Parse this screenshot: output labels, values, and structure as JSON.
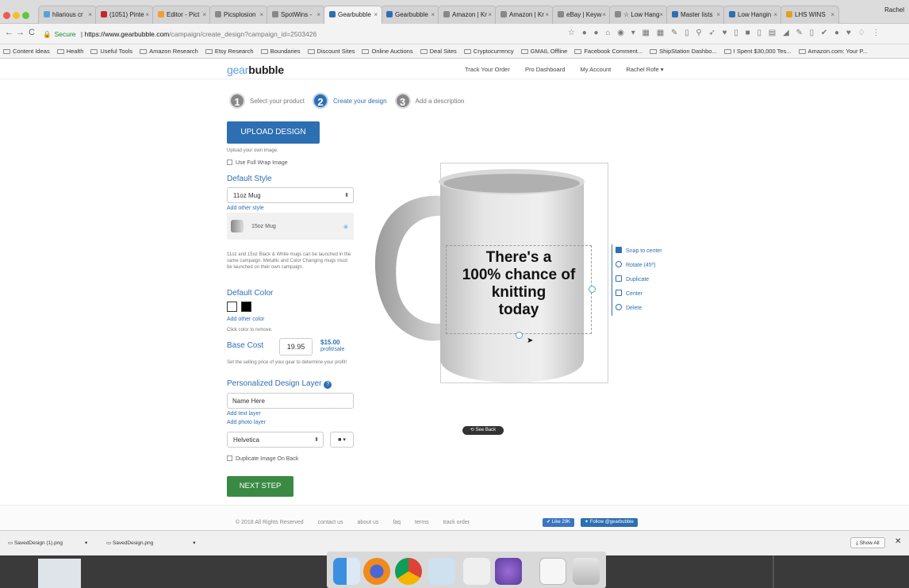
{
  "browser": {
    "tabs": [
      {
        "label": "hilarious cr",
        "color": "#5aa1d8"
      },
      {
        "label": "(1051) Pinte",
        "color": "#c8232c"
      },
      {
        "label": "Editor - Pict",
        "color": "#f0a030"
      },
      {
        "label": "Picsplosion",
        "color": "#888888"
      },
      {
        "label": "SpotWins -",
        "color": "#888888"
      },
      {
        "label": "Gearbubble",
        "color": "#2d6fb3",
        "active": true
      },
      {
        "label": "Gearbubble",
        "color": "#2d6fb3"
      },
      {
        "label": "Amazon | Kr",
        "color": "#888888"
      },
      {
        "label": "Amazon | Kr",
        "color": "#888888"
      },
      {
        "label": "eBay | Keyw",
        "color": "#888888"
      },
      {
        "label": "☆ Low Hang",
        "color": "#888888"
      },
      {
        "label": "Master lists",
        "color": "#2d6fb3"
      },
      {
        "label": "Low Hangin",
        "color": "#2d6fb3"
      },
      {
        "label": "LHS WINS",
        "color": "#e0a020"
      }
    ],
    "profile": "Rachel",
    "secure_label": "Secure",
    "url_host": "https://www.gearbubble.com",
    "url_path": "/campaign/create_design?campaign_id=2503426",
    "bookmarks": [
      "Content Ideas",
      "Health",
      "Useful Tools",
      "Amazon Research",
      "Etsy Research",
      "Boundaries",
      "Discount Sites",
      "Online Auctions",
      "Deal Sites",
      "Cryptocurrency",
      "GMAIL Offline",
      "Facebook Comment...",
      "ShipStation Dashbo...",
      "I Spent $30,000 Tes...",
      "Amazon.com: Your P..."
    ]
  },
  "site": {
    "logo_a": "gear",
    "logo_b": "bubble",
    "nav": [
      "Track Your Order",
      "Pro Dashboard",
      "My Account",
      "Rachel Rofe ▾"
    ]
  },
  "steps": [
    {
      "num": "1",
      "label": "Select your product"
    },
    {
      "num": "2",
      "label": "Create your design"
    },
    {
      "num": "3",
      "label": "Add a description"
    }
  ],
  "form": {
    "upload_label": "UPLOAD DESIGN",
    "upload_hint": "Upload your own image.",
    "full_wrap": "Use Full Wrap Image",
    "default_style_title": "Default Style",
    "style_value": "11oz Mug",
    "add_other_style": "Add other style",
    "style_item": "15oz Mug",
    "style_note": "11oz and 15oz Black & White mugs can be launched in the same campaign. Metallic and Color Changing mugs must be launched on their own campaign.",
    "default_color_title": "Default Color",
    "colors": [
      "#ffffff",
      "#000000"
    ],
    "add_other_color": "Add other color",
    "click_remove": "Click color to remove.",
    "base_cost_title": "Base Cost",
    "base_cost_value": "19.95",
    "profit_value": "$15.00",
    "profit_label": "profit/sale",
    "price_hint": "Set the selling price of your gear to determine your profit!",
    "personalized_title": "Personalized Design Layer",
    "name_placeholder": "Name Here",
    "add_text_layer": "Add text layer",
    "add_photo_layer": "Add photo layer",
    "font_value": "Helvetica",
    "duplicate_back": "Duplicate Image On Back",
    "next_step": "NEXT STEP"
  },
  "canvas": {
    "design_text_1": "There's a",
    "design_text_2": "100% chance of",
    "design_text_3": "knitting",
    "design_text_4": "today",
    "tools": [
      "Snap to center",
      "Rotate (45º)",
      "Duplicate",
      "Center",
      "Delete"
    ],
    "see_back": "See Back"
  },
  "footer": {
    "copyright": "© 2018 All Rights Reserved",
    "links": [
      "contact us",
      "about us",
      "faq",
      "terms",
      "track order"
    ],
    "like": "Like 29K",
    "follow": "Follow @gearbubble"
  },
  "downloads": {
    "items": [
      "SavedDesign (1).png",
      "SavedDesign.png"
    ],
    "show_all": "Show All"
  }
}
